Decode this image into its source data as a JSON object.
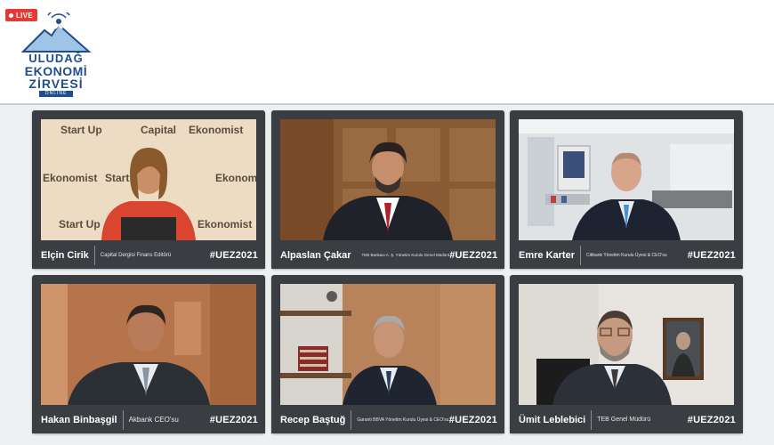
{
  "header": {
    "live_label": "LIVE",
    "logo_lines": [
      "ULUDAĞ",
      "EKONOMİ",
      "ZİRVESİ",
      "ONLINE"
    ]
  },
  "backdrop_words": [
    "Start Up",
    "Capital",
    "Ekonomist"
  ],
  "tiles": [
    {
      "name": "Elçin Cirik",
      "role": "Capital Dergisi Finans Editörü",
      "tag": "#UEZ2021"
    },
    {
      "name": "Alpaslan Çakar",
      "role": "TEB Bankası A. Ş. Yönetim Kurulu Genel Müdürü",
      "tag": "#UEZ2021"
    },
    {
      "name": "Emre Karter",
      "role": "Citibank Yönetim Kurulu Üyesi & CEO'su",
      "tag": "#UEZ2021"
    },
    {
      "name": "Hakan Binbaşgil",
      "role": "Akbank CEO'su",
      "tag": "#UEZ2021"
    },
    {
      "name": "Recep Baştuğ",
      "role": "Garanti BBVA Yönetim Kurulu Üyesi & CEO'su",
      "tag": "#UEZ2021"
    },
    {
      "name": "Ümit Leblebici",
      "role": "TEB Genel Müdürü",
      "tag": "#UEZ2021"
    }
  ],
  "colors": {
    "live": "#e53935",
    "brand": "#1f4e8c",
    "tile": "#3a3d41"
  }
}
